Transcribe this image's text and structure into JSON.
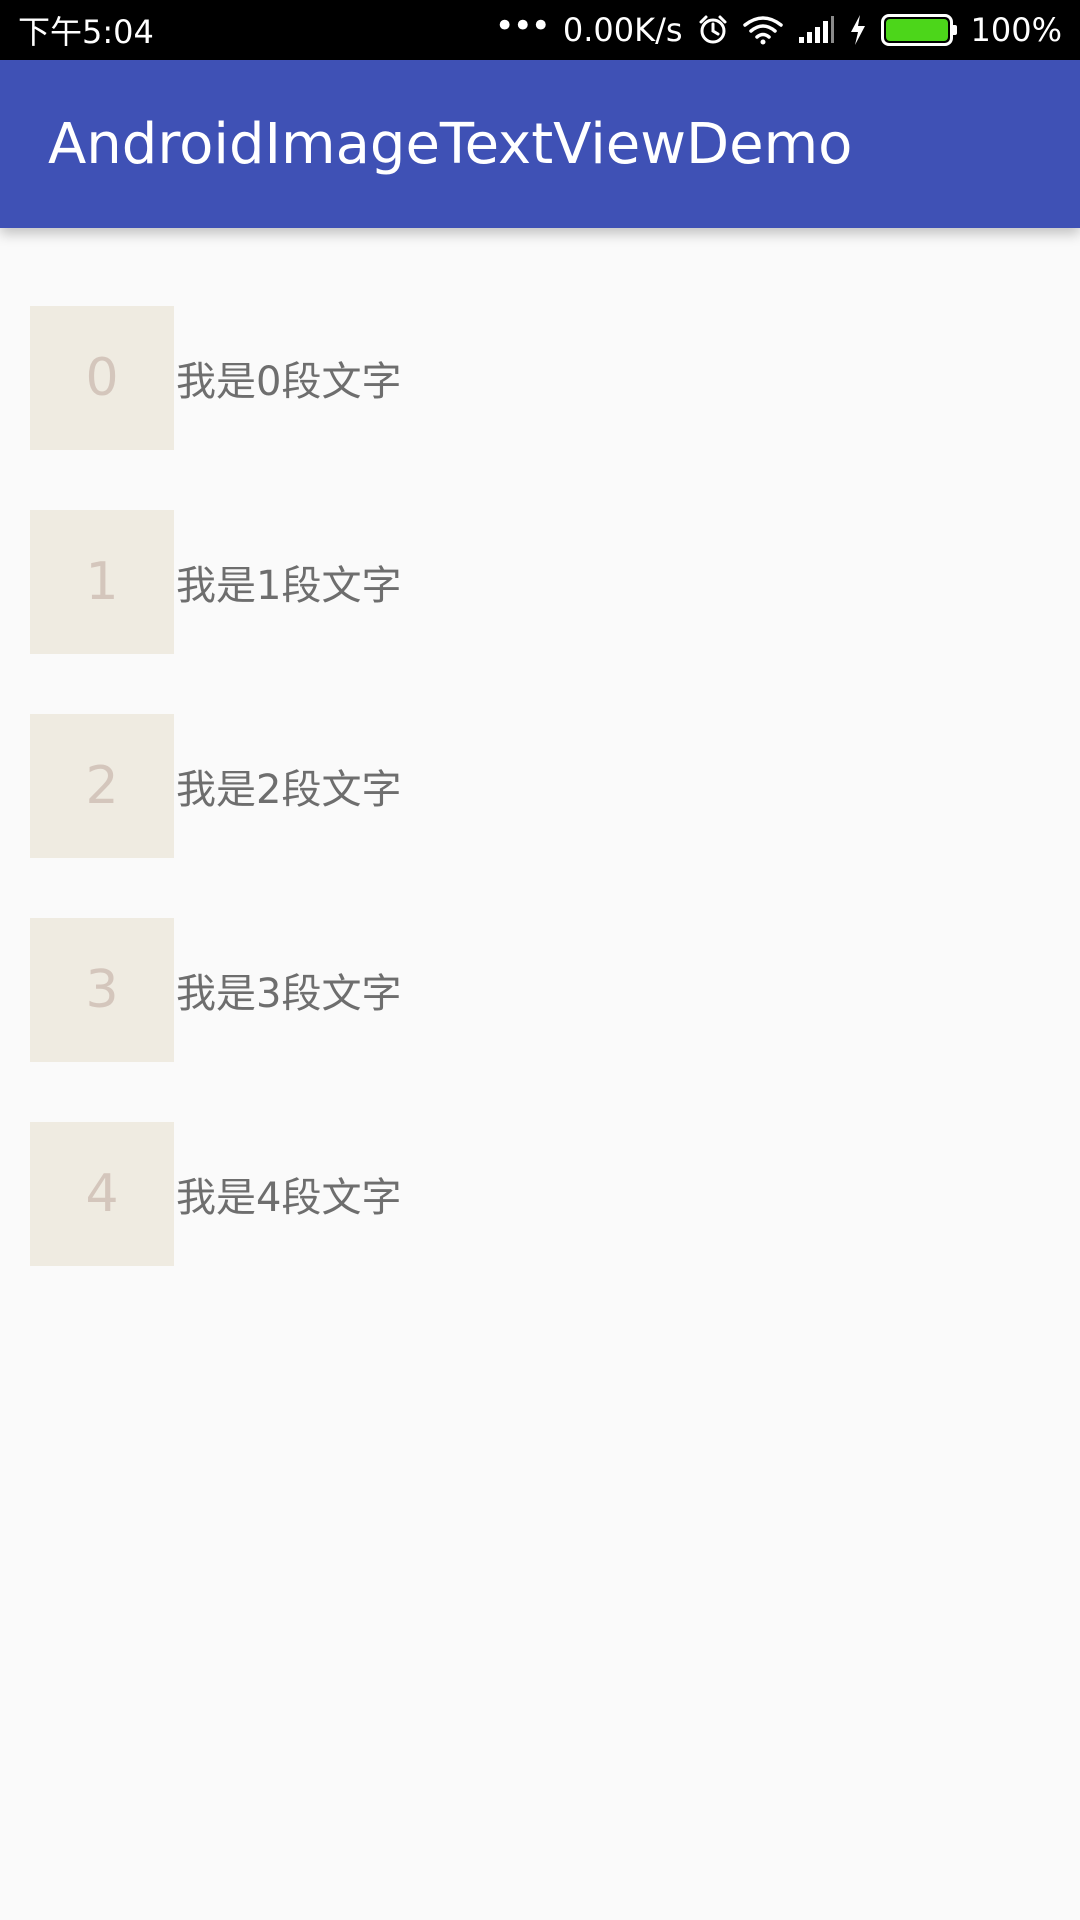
{
  "status_bar": {
    "time": "下午5:04",
    "more_indicator": "•••",
    "network_speed": "0.00K/s",
    "battery_percent": "100%",
    "battery_level": 1.0,
    "icons": [
      "alarm-icon",
      "wifi-icon",
      "signal-icon",
      "charging-icon",
      "battery-icon"
    ],
    "battery_color": "#4cd61a"
  },
  "app_bar": {
    "title": "AndroidImageTextViewDemo",
    "color": "#3f51b5"
  },
  "list": {
    "items": [
      {
        "image_label": "0",
        "text": "我是0段文字"
      },
      {
        "image_label": "1",
        "text": "我是1段文字"
      },
      {
        "image_label": "2",
        "text": "我是2段文字"
      },
      {
        "image_label": "3",
        "text": "我是3段文字"
      },
      {
        "image_label": "4",
        "text": "我是4段文字"
      }
    ]
  }
}
